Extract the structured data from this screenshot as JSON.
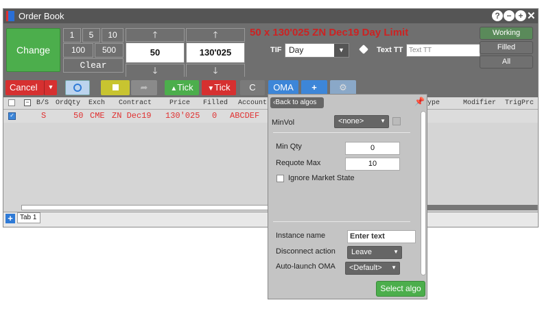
{
  "window": {
    "title": "Order Book"
  },
  "titlebar_icons": [
    "help-icon",
    "minimize-icon",
    "add-icon",
    "close-icon"
  ],
  "toolbar": {
    "change_label": "Change",
    "qty_buttons": [
      "1",
      "5",
      "10",
      "100",
      "500"
    ],
    "clear_label": "Clear",
    "qty_value": "50",
    "price_value": "130'025",
    "up_arrow": "🡑",
    "down_arrow": "🡓",
    "order_summary": "50 x 130'025 ZN Dec19 Day Limit",
    "tif_label": "TIF",
    "tif_value": "Day",
    "texttt_label": "Text TT",
    "texttt_placeholder": "Text TT",
    "status_buttons": [
      "Working",
      "Filled",
      "All"
    ]
  },
  "actionbar": {
    "cancel_label": "Cancel",
    "tick_up_label": "Tick",
    "tick_down_label": "Tick",
    "refresh_label": "C",
    "oma_label": "OMA",
    "plus_label": "+"
  },
  "grid": {
    "columns": [
      "B/S",
      "OrdQty",
      "Exch",
      "Contract",
      "Price",
      "Filled",
      "Account",
      "ype",
      "Modifier",
      "TrigPrc"
    ],
    "row": {
      "bs": "S",
      "ordqty": "50",
      "exch": "CME",
      "contract": "ZN Dec19",
      "price": "130'025",
      "filled": "0",
      "account": "ABCDEF"
    }
  },
  "tabs": {
    "add": "+",
    "items": [
      "Tab 1"
    ]
  },
  "algo_panel": {
    "back_label": "Back to algos",
    "minvol_label": "MinVol",
    "minvol_value": "<none>",
    "min_qty_label": "Min Qty",
    "min_qty_value": "0",
    "requote_max_label": "Requote Max",
    "requote_max_value": "10",
    "ignore_market_label": "Ignore Market State",
    "instance_name_label": "Instance name",
    "instance_name_placeholder": "Enter text",
    "disconnect_label": "Disconnect action",
    "disconnect_value": "Leave",
    "autolaunch_label": "Auto-launch OMA",
    "autolaunch_value": "<Default>",
    "select_algo_label": "Select algo"
  },
  "colors": {
    "buy_sell_red": "#e03030",
    "green": "#4cae4c",
    "blue": "#2f7ad6",
    "toolbar": "#6f6f6f"
  }
}
